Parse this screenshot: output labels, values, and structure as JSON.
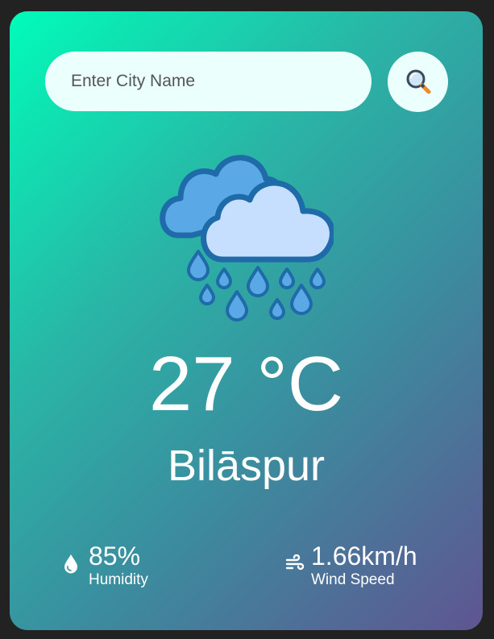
{
  "search": {
    "placeholder": "Enter City Name",
    "value": ""
  },
  "weather": {
    "condition_icon": "rain-cloud-icon",
    "temperature": "27 °C",
    "city": "Bilāspur"
  },
  "details": {
    "humidity": {
      "icon": "humidity-drop-icon",
      "value": "85%",
      "label": "Humidity"
    },
    "wind": {
      "icon": "wind-icon",
      "value": "1.66km/h",
      "label": "Wind Speed"
    }
  },
  "colors": {
    "gradient_start": "#00fcb9",
    "gradient_end": "#5f5591",
    "input_bg": "#ebfffc",
    "text": "#ffffff"
  }
}
